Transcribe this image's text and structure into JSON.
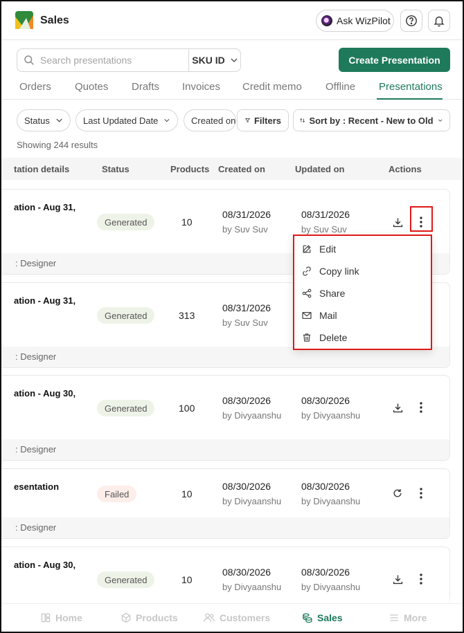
{
  "app": {
    "title": "Sales"
  },
  "header": {
    "ask_label": "Ask WizPilot"
  },
  "search": {
    "placeholder": "Search presentations",
    "filter_select": "SKU ID"
  },
  "actions": {
    "create_label": "Create Presentation"
  },
  "tabs": [
    {
      "label": "Orders"
    },
    {
      "label": "Quotes"
    },
    {
      "label": "Drafts"
    },
    {
      "label": "Invoices"
    },
    {
      "label": "Credit memo"
    },
    {
      "label": "Offline"
    },
    {
      "label": "Presentations"
    }
  ],
  "filters": {
    "status": "Status",
    "last_updated": "Last Updated Date",
    "created_on": "Created on",
    "filters_label": "Filters",
    "sort_label": "Sort by : Recent - New to Old"
  },
  "results_text": "Showing 244 results",
  "table_header": {
    "details": "tation details",
    "status": "Status",
    "products": "Products",
    "created": "Created on",
    "updated": "Updated on",
    "actions": "Actions"
  },
  "rows": [
    {
      "name": "ation - Aug 31,",
      "status": "Generated",
      "products": "10",
      "created": "08/31/2026",
      "created_by": "by Suv Suv",
      "updated": "08/31/2026",
      "updated_by": "by Suv Suv",
      "footer": ": Designer"
    },
    {
      "name": "ation - Aug 31,",
      "status": "Generated",
      "products": "313",
      "created": "08/31/2026",
      "created_by": "by Suv Suv",
      "footer": ": Designer"
    },
    {
      "name": "ation - Aug 30,",
      "status": "Generated",
      "products": "100",
      "created": "08/30/2026",
      "created_by": "by Divyaanshu",
      "updated": "08/30/2026",
      "updated_by": "by Divyaanshu",
      "footer": ": Designer"
    },
    {
      "name": "esentation",
      "status": "Failed",
      "products": "10",
      "created": "08/30/2026",
      "created_by": "by Divyaanshu",
      "updated": "08/30/2026",
      "updated_by": "by Divyaanshu",
      "footer": ": Designer"
    },
    {
      "name": "ation - Aug 30,",
      "status": "Generated",
      "products": "10",
      "created": "08/30/2026",
      "created_by": "by Divyaanshu",
      "updated": "08/30/2026",
      "updated_by": "by Divyaanshu"
    }
  ],
  "menu": [
    {
      "label": "Edit",
      "icon": "pencil-icon"
    },
    {
      "label": "Copy link",
      "icon": "link-icon"
    },
    {
      "label": "Share",
      "icon": "share-icon"
    },
    {
      "label": "Mail",
      "icon": "mail-icon"
    },
    {
      "label": "Delete",
      "icon": "trash-icon"
    }
  ],
  "bottom_nav": [
    {
      "label": "Home"
    },
    {
      "label": "Products"
    },
    {
      "label": "Customers"
    },
    {
      "label": "Sales"
    },
    {
      "label": "More"
    }
  ],
  "colors": {
    "accent": "#1e7a5a",
    "highlight": "#e01818"
  }
}
